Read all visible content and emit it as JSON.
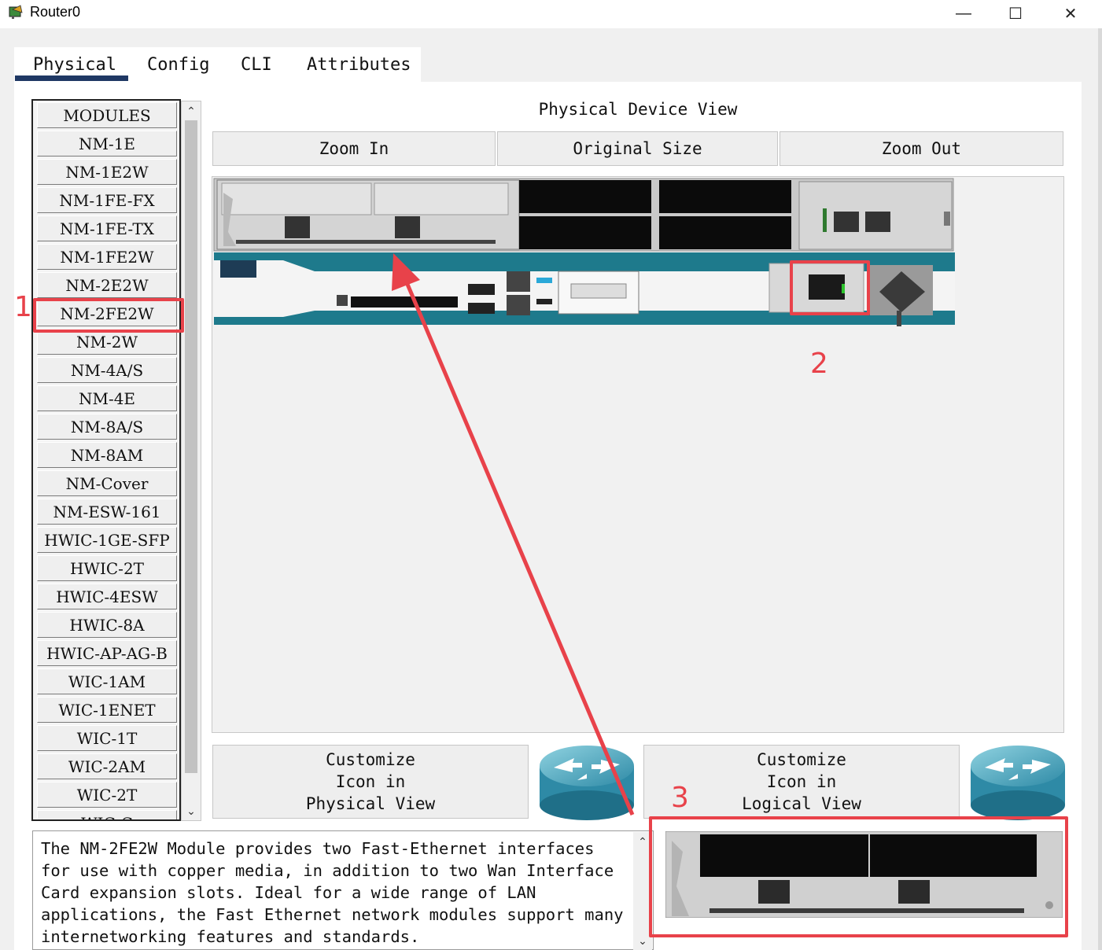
{
  "window": {
    "title": "Router0",
    "minimize": "—",
    "maximize": "☐",
    "close": "✕"
  },
  "tabs": [
    {
      "label": "Physical",
      "active": true
    },
    {
      "label": "Config"
    },
    {
      "label": "CLI"
    },
    {
      "label": "Attributes"
    }
  ],
  "modules": {
    "items": [
      "MODULES",
      "NM-1E",
      "NM-1E2W",
      "NM-1FE-FX",
      "NM-1FE-TX",
      "NM-1FE2W",
      "NM-2E2W",
      "NM-2FE2W",
      "NM-2W",
      "NM-4A/S",
      "NM-4E",
      "NM-8A/S",
      "NM-8AM",
      "NM-Cover",
      "NM-ESW-161",
      "HWIC-1GE-SFP",
      "HWIC-2T",
      "HWIC-4ESW",
      "HWIC-8A",
      "HWIC-AP-AG-B",
      "WIC-1AM",
      "WIC-1ENET",
      "WIC-1T",
      "WIC-2AM",
      "WIC-2T",
      "WIC-C"
    ],
    "selected": "NM-2FE2W"
  },
  "physical_view": {
    "title": "Physical Device View",
    "zoom_in": "Zoom In",
    "original_size": "Original Size",
    "zoom_out": "Zoom Out"
  },
  "customize": {
    "physical": [
      "Customize",
      "Icon in",
      "Physical View"
    ],
    "logical": [
      "Customize",
      "Icon in",
      "Logical View"
    ]
  },
  "description": "The NM-2FE2W Module provides two Fast-Ethernet interfaces for use with copper media, in addition to two Wan Interface Card expansion slots. Ideal for a wide range of LAN applications, the Fast Ethernet network modules support many internetworking features and standards.",
  "annotations": [
    "1",
    "2",
    "3"
  ],
  "colors": {
    "annotation": "#e8424a",
    "tab_underline": "#1f3864",
    "router_teal": "#1e7a8c"
  }
}
